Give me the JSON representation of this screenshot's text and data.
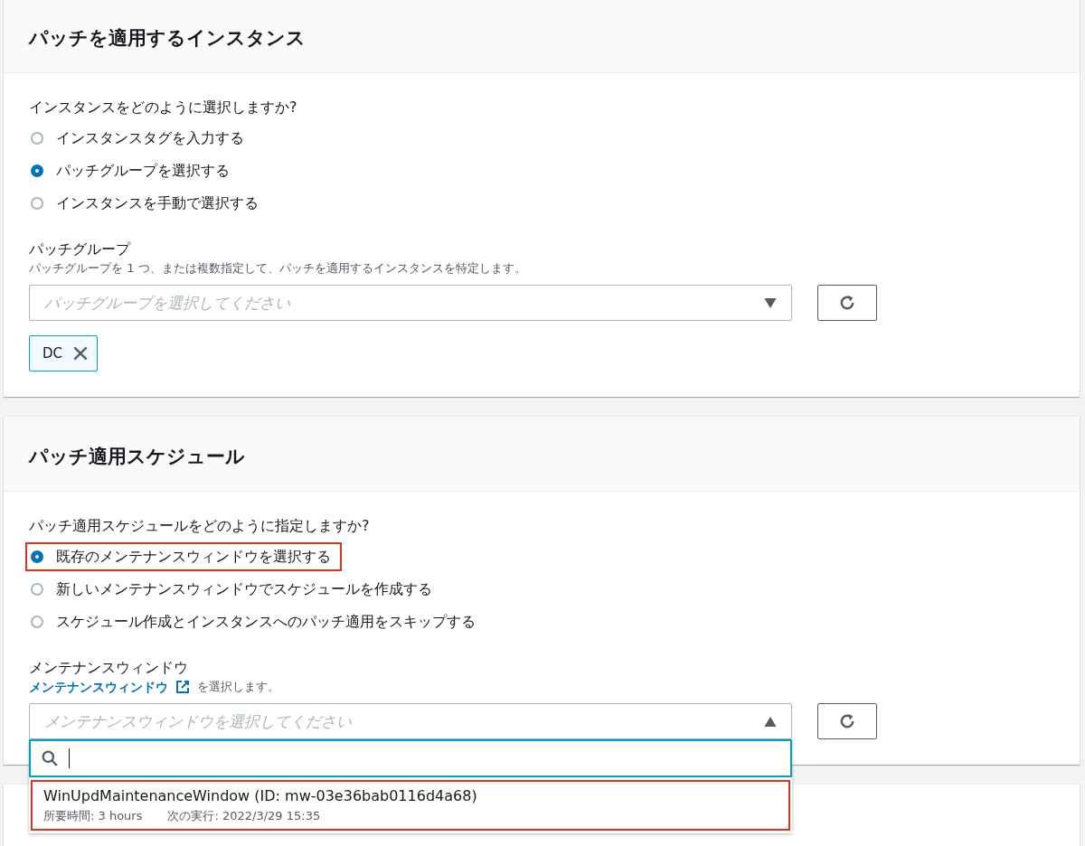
{
  "panels": [
    {
      "title": "パッチを適用するインスタンス",
      "question": "インスタンスをどのように選択しますか?",
      "options": [
        {
          "label": "インスタンスタグを入力する",
          "selected": false,
          "highlighted": false
        },
        {
          "label": "パッチグループを選択する",
          "selected": true,
          "highlighted": false
        },
        {
          "label": "インスタンスを手動で選択する",
          "selected": false,
          "highlighted": false
        }
      ],
      "field": {
        "label": "パッチグループ",
        "description": "パッチグループを 1 つ、または複数指定して、パッチを適用するインスタンスを特定します。",
        "placeholder": "パッチグループを選択してください",
        "expanded": false
      },
      "tokens": [
        "DC"
      ]
    },
    {
      "title": "パッチ適用スケジュール",
      "question": "パッチ適用スケジュールをどのように指定しますか?",
      "options": [
        {
          "label": "既存のメンテナンスウィンドウを選択する",
          "selected": true,
          "highlighted": true
        },
        {
          "label": "新しいメンテナンスウィンドウでスケジュールを作成する",
          "selected": false,
          "highlighted": false
        },
        {
          "label": "スケジュール作成とインスタンスへのパッチ適用をスキップする",
          "selected": false,
          "highlighted": false
        }
      ],
      "field": {
        "label": "メンテナンスウィンドウ",
        "description_link": "メンテナンスウィンドウ",
        "description": "を選択します。",
        "placeholder": "メンテナンスウィンドウを選択してください",
        "expanded": true,
        "results": [
          {
            "title": "WinUpdMaintenanceWindow (ID: mw-03e36bab0116d4a68)",
            "duration": "所要時間: 3 hours",
            "next_run": "次の実行: 2022/3/29 15:35",
            "highlighted": true
          }
        ]
      }
    }
  ]
}
